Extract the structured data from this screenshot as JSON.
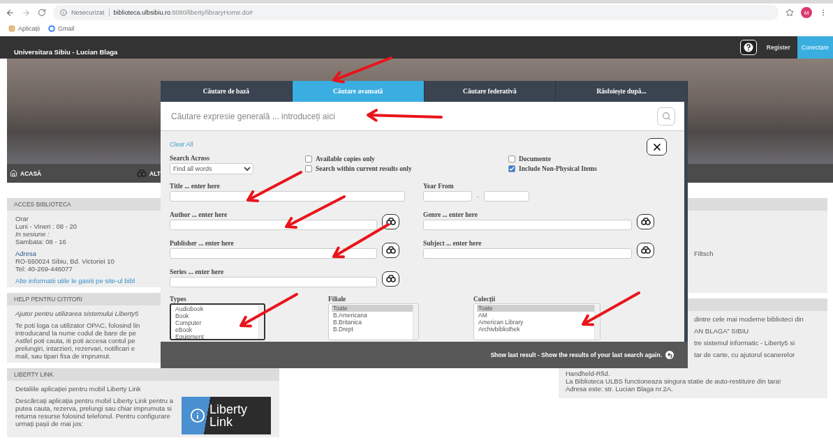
{
  "browser": {
    "security_label": "Nesecurizat",
    "url": "**biblioteca.ulbsibiu.ro**:8080/liberty/libraryHome.do#",
    "avatar": "M",
    "bookmarks": [
      {
        "label": "Aplicații",
        "kind": "apps"
      },
      {
        "label": "Gmail",
        "kind": "site"
      }
    ]
  },
  "header": {
    "title": "Universitara Sibiu - Lucian Blaga",
    "register": "Register",
    "login": "Conectare"
  },
  "nav": [
    {
      "label": "ACASĂ",
      "kind": "home"
    },
    {
      "label": "ALT",
      "kind": "search"
    }
  ],
  "left_panels": [
    {
      "heading": "ACCES BIBLIOTECA",
      "blocks": [
        [
          {
            "kind": "plain",
            "text": "Orar"
          },
          {
            "kind": "plain",
            "text": "Luni - Vineri : 08 - 20"
          },
          {
            "kind": "italic",
            "text": "In sesiune :"
          },
          {
            "kind": "plain",
            "text": "Sambata: 08 - 16"
          }
        ],
        [
          {
            "kind": "label",
            "text": "Adresa"
          },
          {
            "kind": "plain",
            "text": "RO-550024 Sibiu, Bd. Victoriei 10"
          },
          {
            "kind": "plain",
            "text": "Tel: 40-269-446077"
          }
        ],
        [
          {
            "kind": "link",
            "text": "Alte informatii utile le gasiti pe site-ul bibl"
          }
        ]
      ]
    },
    {
      "heading": "HELP PENTRU CITITORI",
      "blocks": [
        [
          {
            "kind": "italic",
            "text": "Ajutor pentru utilizarea sistemului Liberty5"
          }
        ],
        [
          {
            "kind": "plain",
            "text": "Te poti loga ca utilizator OPAC, folosind lin"
          },
          {
            "kind": "plain",
            "text": "introducand la nume codul de bare de pe"
          },
          {
            "kind": "plain",
            "text": "Astfel poti cauta, iti poti accesa contul pe"
          },
          {
            "kind": "plain",
            "text": "prelungiri, intarzieri, rezervari, notificari e"
          },
          {
            "kind": "plain",
            "text": "mail, sau tipari fisa de imprumut."
          }
        ]
      ]
    },
    {
      "heading": "LIBERTY LINK",
      "blocks": [
        [
          {
            "kind": "plain",
            "text": "Detaliile aplicației pentru mobil Liberty Link"
          }
        ]
      ],
      "promo": {
        "text": "Descărcați aplicația pentru mobil Liberty Link pentru a putea cauta, rezerva, prelungi sau chiar imprumuta si returna resurse folosind telefonul. Pentru configurare urmați pașii de mai jos:",
        "logo": [
          "Liberty",
          "Link"
        ]
      }
    }
  ],
  "right_panels": [
    {
      "partial_lines": [
        "Filtsch"
      ]
    },
    {
      "partial_lines": [
        "dintre cele mai moderne biblioteci din",
        "AN BLAGA” SIBIU",
        "tre sistemul informatic - Liberty5 si",
        "tar de carte, cu ajutorul scanerelor"
      ],
      "lines": [
        "Handheld-Rfid.",
        "La Biblioteca ULBS functioneaza singura statie de auto-restituire din tara!",
        "Adresa este: str. Lucian Blaga nr.2A."
      ]
    }
  ],
  "modal": {
    "tabs": [
      {
        "label": "Căutare de bază",
        "selected": false
      },
      {
        "label": "Căutare avansată",
        "selected": true
      },
      {
        "label": "Căutare federativă",
        "selected": false
      },
      {
        "label": "Răsfoiește după...",
        "selected": false
      }
    ],
    "search": {
      "placeholder": "Căutare expresie generală ... introduceți aici"
    },
    "clear": "Clear All",
    "search_across": {
      "label": "Search Across",
      "value": "Find all words"
    },
    "checkbox_groups": [
      [
        {
          "label": "Available copies only",
          "checked": false
        },
        {
          "label": "Search within current results only",
          "checked": false
        }
      ],
      [
        {
          "label": "Documente",
          "checked": false
        },
        {
          "label": "Include Non-Physical Items",
          "checked": true
        }
      ]
    ],
    "field_columns": [
      [
        {
          "kind": "text",
          "label": "Title ... enter here"
        },
        {
          "kind": "lookup",
          "label": "Author ... enter here"
        },
        {
          "kind": "lookup",
          "label": "Publisher ... enter here"
        },
        {
          "kind": "lookup",
          "label": "Series ... enter here"
        }
      ],
      [
        {
          "kind": "range",
          "label": "Year From",
          "separator": "-"
        },
        {
          "kind": "lookup",
          "label": "Genre ... enter here"
        },
        {
          "kind": "lookup",
          "label": "Subject ... enter here"
        }
      ]
    ],
    "lists": [
      {
        "label": "Types",
        "focused": true,
        "items": [
          {
            "text": "Audiobook",
            "selected": false
          },
          {
            "text": "Book",
            "selected": false
          },
          {
            "text": "Computer",
            "selected": false
          },
          {
            "text": "eBook",
            "selected": false
          },
          {
            "text": "Equipment",
            "selected": false
          }
        ]
      },
      {
        "label": "Filiale",
        "focused": false,
        "items": [
          {
            "text": "Toate",
            "selected": true
          },
          {
            "text": "B.Americana",
            "selected": false
          },
          {
            "text": "B.Britanica",
            "selected": false
          },
          {
            "text": "B.Drept",
            "selected": false
          }
        ]
      },
      {
        "label": "Colecții",
        "focused": false,
        "items": [
          {
            "text": "Toate",
            "selected": true
          },
          {
            "text": "AM",
            "selected": false
          },
          {
            "text": "American Library",
            "selected": false
          },
          {
            "text": "Archivbibliothek",
            "selected": false
          }
        ]
      }
    ],
    "footer": "Show last result - Show the results of your last search again."
  }
}
